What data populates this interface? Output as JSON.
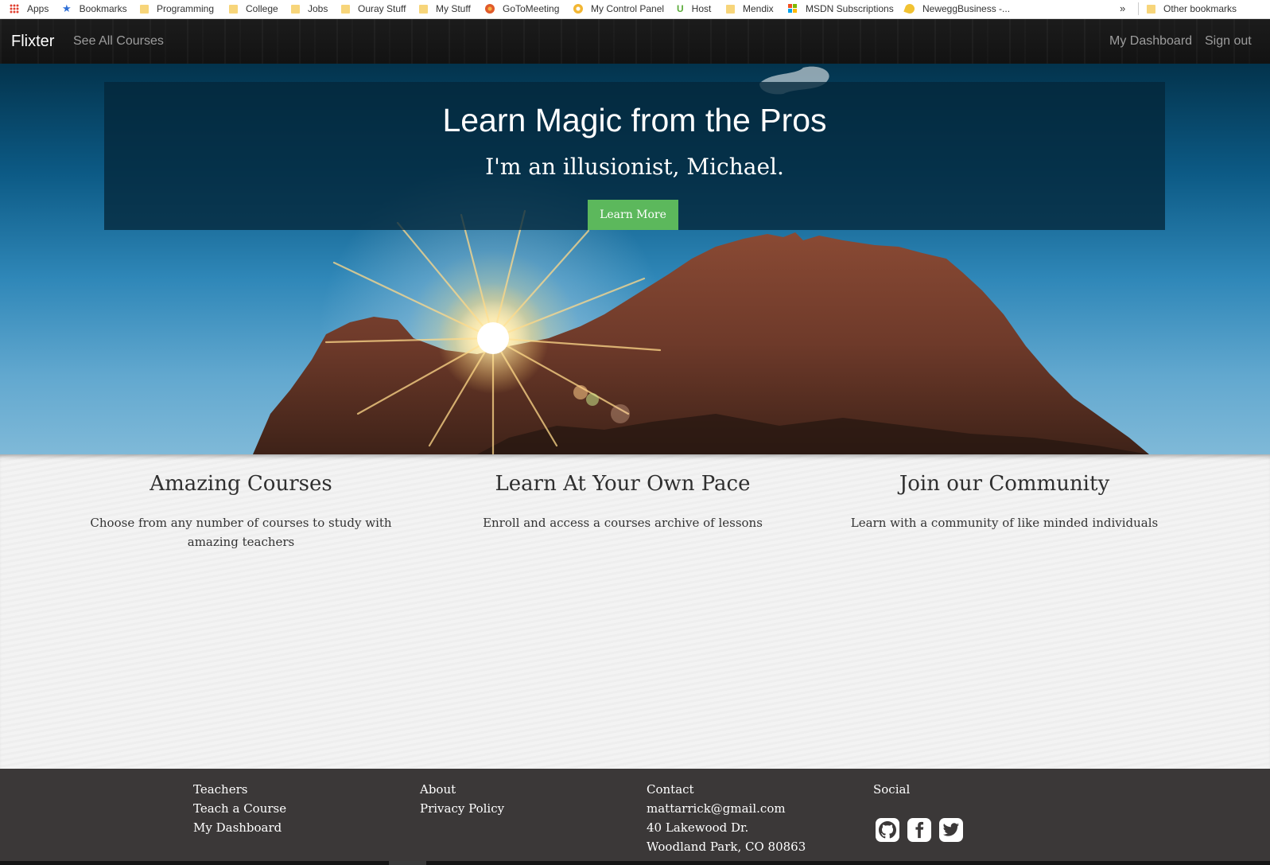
{
  "bookmarks": {
    "items": [
      {
        "label": "Apps"
      },
      {
        "label": "Bookmarks"
      },
      {
        "label": "Programming"
      },
      {
        "label": "College"
      },
      {
        "label": "Jobs"
      },
      {
        "label": "Ouray Stuff"
      },
      {
        "label": "My Stuff"
      },
      {
        "label": "GoToMeeting"
      },
      {
        "label": "My Control Panel"
      },
      {
        "label": "Host"
      },
      {
        "label": "Mendix"
      },
      {
        "label": "MSDN Subscriptions"
      },
      {
        "label": "NeweggBusiness -..."
      }
    ],
    "more": "»",
    "other": "Other bookmarks"
  },
  "nav": {
    "brand": "Flixter",
    "see_all": "See All Courses",
    "dashboard": "My Dashboard",
    "signout": "Sign out"
  },
  "hero": {
    "title": "Learn Magic from the Pros",
    "subtitle": "I'm an illusionist, Michael.",
    "button": "Learn More"
  },
  "features": [
    {
      "title": "Amazing Courses",
      "text": "Choose from any number of courses to study with amazing teachers"
    },
    {
      "title": "Learn At Your Own Pace",
      "text": "Enroll and access a courses archive of lessons"
    },
    {
      "title": "Join our Community",
      "text": "Learn with a community of like minded individuals"
    }
  ],
  "footer": {
    "teachers": {
      "heading": "Teachers",
      "links": [
        "Teach a Course",
        "My Dashboard"
      ]
    },
    "about": {
      "heading": "About",
      "links": [
        "Privacy Policy"
      ]
    },
    "contact": {
      "heading": "Contact",
      "email": "mattarrick@gmail.com",
      "address1": "40 Lakewood Dr.",
      "address2": "Woodland Park, CO 80863"
    },
    "social": {
      "heading": "Social",
      "icons": [
        "github-icon",
        "facebook-icon",
        "twitter-icon"
      ]
    }
  },
  "colors": {
    "navbar": "#151515",
    "button_green": "#5cb85c",
    "footer": "#3b3838"
  }
}
